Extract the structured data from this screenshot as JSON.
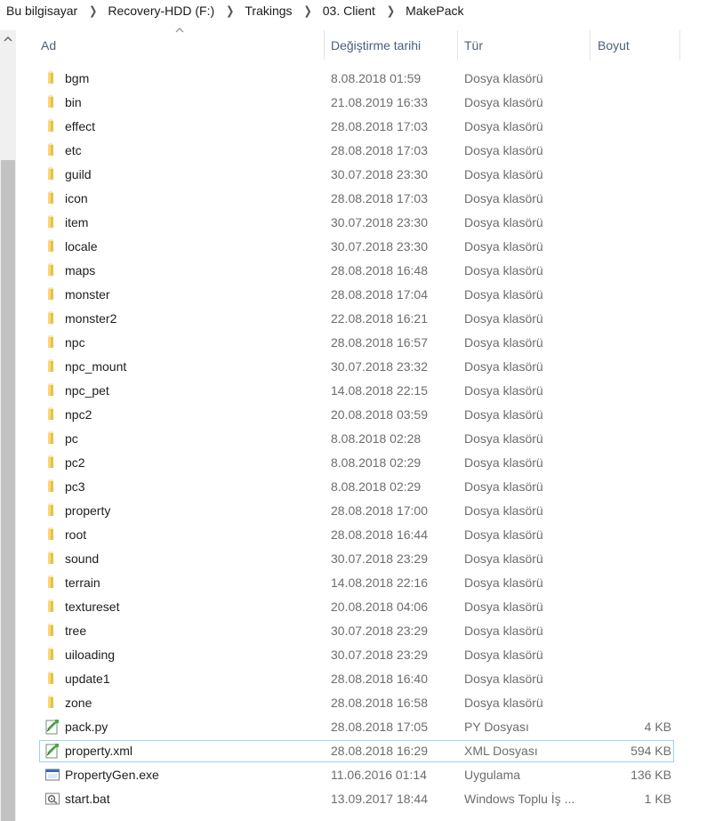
{
  "breadcrumb": [
    {
      "label": "Bu bilgisayar"
    },
    {
      "label": "Recovery-HDD (F:)"
    },
    {
      "label": "Trakings"
    },
    {
      "label": "03. Client"
    },
    {
      "label": "MakePack"
    }
  ],
  "columns": {
    "name": "Ad",
    "date": "Değiştirme tarihi",
    "type": "Tür",
    "size": "Boyut"
  },
  "colors": {
    "folder": "#e8c04a",
    "selection_border": "#99d1ff",
    "header_text": "#4c607a"
  },
  "files": [
    {
      "name": "bgm",
      "date": "8.08.2018 01:59",
      "type": "Dosya klasörü",
      "size": "",
      "icon": "folder-icon"
    },
    {
      "name": "bin",
      "date": "21.08.2019 16:33",
      "type": "Dosya klasörü",
      "size": "",
      "icon": "folder-icon"
    },
    {
      "name": "effect",
      "date": "28.08.2018 17:03",
      "type": "Dosya klasörü",
      "size": "",
      "icon": "folder-icon"
    },
    {
      "name": "etc",
      "date": "28.08.2018 17:03",
      "type": "Dosya klasörü",
      "size": "",
      "icon": "folder-icon"
    },
    {
      "name": "guild",
      "date": "30.07.2018 23:30",
      "type": "Dosya klasörü",
      "size": "",
      "icon": "folder-icon"
    },
    {
      "name": "icon",
      "date": "28.08.2018 17:03",
      "type": "Dosya klasörü",
      "size": "",
      "icon": "folder-icon"
    },
    {
      "name": "item",
      "date": "30.07.2018 23:30",
      "type": "Dosya klasörü",
      "size": "",
      "icon": "folder-icon"
    },
    {
      "name": "locale",
      "date": "30.07.2018 23:30",
      "type": "Dosya klasörü",
      "size": "",
      "icon": "folder-icon"
    },
    {
      "name": "maps",
      "date": "28.08.2018 16:48",
      "type": "Dosya klasörü",
      "size": "",
      "icon": "folder-icon"
    },
    {
      "name": "monster",
      "date": "28.08.2018 17:04",
      "type": "Dosya klasörü",
      "size": "",
      "icon": "folder-icon"
    },
    {
      "name": "monster2",
      "date": "22.08.2018 16:21",
      "type": "Dosya klasörü",
      "size": "",
      "icon": "folder-icon"
    },
    {
      "name": "npc",
      "date": "28.08.2018 16:57",
      "type": "Dosya klasörü",
      "size": "",
      "icon": "folder-icon"
    },
    {
      "name": "npc_mount",
      "date": "30.07.2018 23:32",
      "type": "Dosya klasörü",
      "size": "",
      "icon": "folder-icon"
    },
    {
      "name": "npc_pet",
      "date": "14.08.2018 22:15",
      "type": "Dosya klasörü",
      "size": "",
      "icon": "folder-icon"
    },
    {
      "name": "npc2",
      "date": "20.08.2018 03:59",
      "type": "Dosya klasörü",
      "size": "",
      "icon": "folder-icon"
    },
    {
      "name": "pc",
      "date": "8.08.2018 02:28",
      "type": "Dosya klasörü",
      "size": "",
      "icon": "folder-icon"
    },
    {
      "name": "pc2",
      "date": "8.08.2018 02:29",
      "type": "Dosya klasörü",
      "size": "",
      "icon": "folder-icon"
    },
    {
      "name": "pc3",
      "date": "8.08.2018 02:29",
      "type": "Dosya klasörü",
      "size": "",
      "icon": "folder-icon"
    },
    {
      "name": "property",
      "date": "28.08.2018 17:00",
      "type": "Dosya klasörü",
      "size": "",
      "icon": "folder-icon"
    },
    {
      "name": "root",
      "date": "28.08.2018 16:44",
      "type": "Dosya klasörü",
      "size": "",
      "icon": "folder-icon"
    },
    {
      "name": "sound",
      "date": "30.07.2018 23:29",
      "type": "Dosya klasörü",
      "size": "",
      "icon": "folder-icon"
    },
    {
      "name": "terrain",
      "date": "14.08.2018 22:16",
      "type": "Dosya klasörü",
      "size": "",
      "icon": "folder-icon"
    },
    {
      "name": "textureset",
      "date": "20.08.2018 04:06",
      "type": "Dosya klasörü",
      "size": "",
      "icon": "folder-icon"
    },
    {
      "name": "tree",
      "date": "30.07.2018 23:29",
      "type": "Dosya klasörü",
      "size": "",
      "icon": "folder-icon"
    },
    {
      "name": "uiloading",
      "date": "30.07.2018 23:29",
      "type": "Dosya klasörü",
      "size": "",
      "icon": "folder-icon"
    },
    {
      "name": "update1",
      "date": "28.08.2018 16:40",
      "type": "Dosya klasörü",
      "size": "",
      "icon": "folder-icon"
    },
    {
      "name": "zone",
      "date": "28.08.2018 16:58",
      "type": "Dosya klasörü",
      "size": "",
      "icon": "folder-icon"
    },
    {
      "name": "pack.py",
      "date": "28.08.2018 17:05",
      "type": "PY Dosyası",
      "size": "4 KB",
      "icon": "notepad-file-icon"
    },
    {
      "name": "property.xml",
      "date": "28.08.2018 16:29",
      "type": "XML Dosyası",
      "size": "594 KB",
      "icon": "notepad-file-icon",
      "selected": true
    },
    {
      "name": "PropertyGen.exe",
      "date": "11.06.2016 01:14",
      "type": "Uygulama",
      "size": "136 KB",
      "icon": "application-icon"
    },
    {
      "name": "start.bat",
      "date": "13.09.2017 18:44",
      "type": "Windows Toplu İş ...",
      "size": "1 KB",
      "icon": "batch-file-icon"
    }
  ]
}
